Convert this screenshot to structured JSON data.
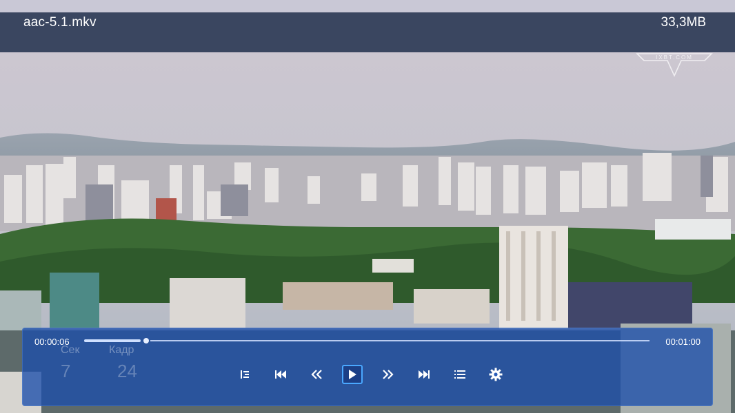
{
  "file": {
    "name": "aac-5.1.mkv",
    "size": "33,3MB"
  },
  "watermark": {
    "text": "IXBT.COM"
  },
  "playback": {
    "current_time": "00:00:06",
    "duration": "00:01:00",
    "progress_fraction": 0.1
  },
  "overlay": {
    "sec_label": "Сек",
    "frame_label": "Кадр",
    "sec_value": "7",
    "frame_value": "24"
  },
  "controls": [
    {
      "name": "chapters-button",
      "icon": "chapters-icon"
    },
    {
      "name": "skip-previous-button",
      "icon": "skip-previous-icon"
    },
    {
      "name": "rewind-button",
      "icon": "rewind-icon"
    },
    {
      "name": "play-button",
      "icon": "play-icon",
      "focused": true
    },
    {
      "name": "fast-forward-button",
      "icon": "fast-forward-icon"
    },
    {
      "name": "skip-next-button",
      "icon": "skip-next-icon"
    },
    {
      "name": "playlist-button",
      "icon": "playlist-icon"
    },
    {
      "name": "settings-button",
      "icon": "gear-icon"
    }
  ],
  "colors": {
    "title_bar": "#3a4660",
    "panel": "#1c4eaa",
    "focus": "#4aa8ff"
  }
}
